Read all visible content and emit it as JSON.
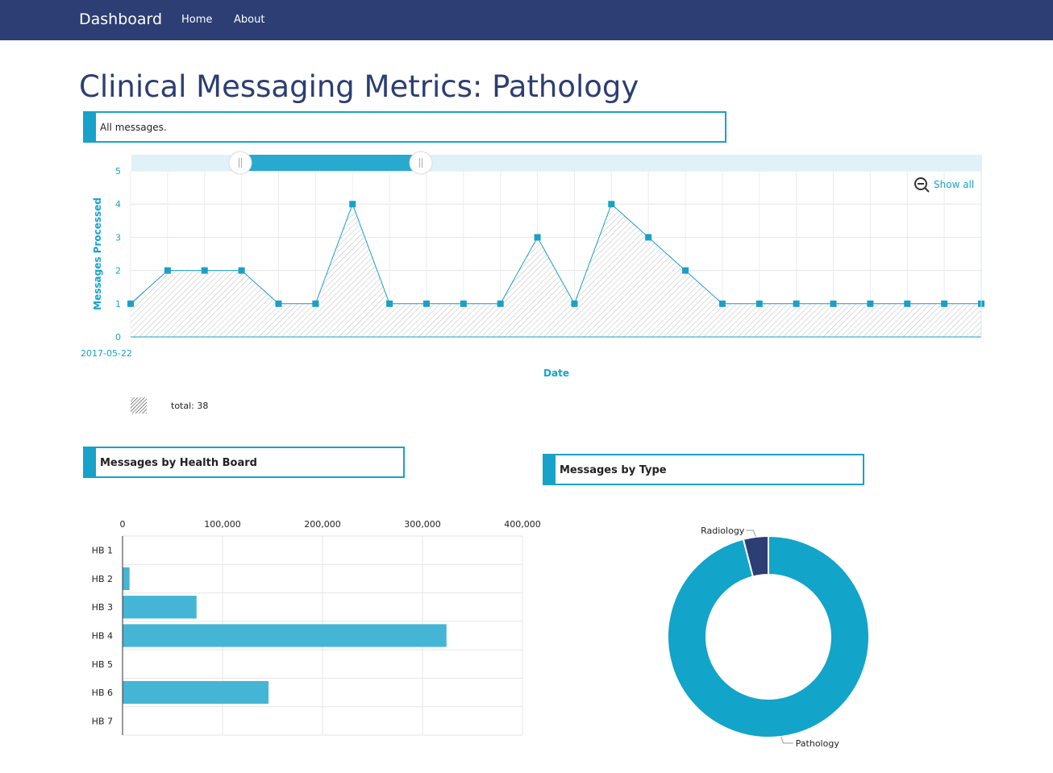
{
  "nav": {
    "brand": "Dashboard",
    "links": [
      "Home",
      "About"
    ]
  },
  "page_title": "Clinical Messaging Metrics: Pathology",
  "panels": {
    "all_messages": "All messages.",
    "health_board": "Messages by Health Board",
    "type": "Messages by Type"
  },
  "line_chart": {
    "show_all_label": "Show all",
    "legend_total": "total: 38"
  },
  "colors": {
    "navbar": "#2c3e73",
    "accent": "#17a2c9",
    "line": "#1aa0c6",
    "bar": "#45b5d6",
    "pie_pathology": "#12a4c9",
    "pie_radiology": "#2c3e73"
  },
  "chart_data": [
    {
      "type": "line",
      "ylabel": "Messages Processed",
      "xlabel": "Date",
      "ylim": [
        0,
        5
      ],
      "yticks": [
        0,
        1,
        2,
        3,
        4,
        5
      ],
      "x_first_label": "2017-05-22",
      "values": [
        1,
        2,
        2,
        2,
        1,
        1,
        4,
        1,
        1,
        1,
        1,
        3,
        1,
        4,
        3,
        2,
        1,
        1,
        1,
        1,
        1,
        1,
        1,
        1
      ],
      "series": [
        {
          "name": "total",
          "total": 38
        }
      ],
      "area": true,
      "grid": true,
      "legend": "bottom-left"
    },
    {
      "type": "bar",
      "orientation": "horizontal",
      "categories": [
        "HB 1",
        "HB 2",
        "HB 3",
        "HB 4",
        "HB 5",
        "HB 6",
        "HB 7"
      ],
      "values": [
        0,
        7000,
        74000,
        324000,
        0,
        146000,
        0
      ],
      "xlim": [
        0,
        400000
      ],
      "xticks": [
        "0",
        "100,000",
        "200,000",
        "300,000",
        "400,000"
      ],
      "grid": true
    },
    {
      "type": "pie",
      "donut": true,
      "labels": [
        "Pathology",
        "Radiology"
      ],
      "values": [
        96,
        4
      ]
    }
  ]
}
